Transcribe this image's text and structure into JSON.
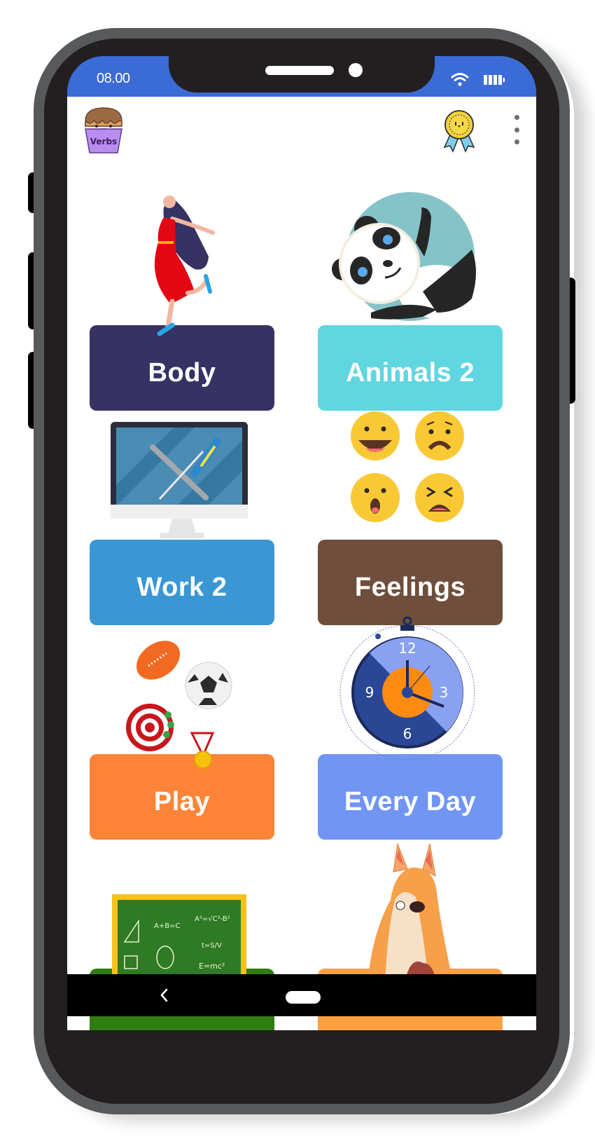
{
  "status_bar": {
    "time": "08.00",
    "icons": [
      "wifi-icon",
      "battery-icon"
    ]
  },
  "app_bar": {
    "logo_text": "Verbs",
    "logo_icon": "cupcake-icon",
    "award_icon": "award-medal-icon",
    "menu_icon": "more-vertical-icon"
  },
  "categories": [
    {
      "label": "Body",
      "color": "#363264",
      "icon": "dancing-woman-icon"
    },
    {
      "label": "Animals 2",
      "color": "#5fd6e0",
      "icon": "panda-icon"
    },
    {
      "label": "Work 2",
      "color": "#3a97d4",
      "icon": "computer-tools-icon"
    },
    {
      "label": "Feelings",
      "color": "#6f4f3b",
      "icon": "emoji-faces-icon"
    },
    {
      "label": "Play",
      "color": "#fd8337",
      "icon": "sports-balls-icon"
    },
    {
      "label": "Every Day",
      "color": "#7095f3",
      "icon": "clock-icon"
    },
    {
      "label": "",
      "color": "#2f7e11",
      "icon": "chalkboard-icon"
    },
    {
      "label": "",
      "color": "#fda042",
      "icon": "dog-icon"
    }
  ],
  "nav_bar": {
    "back_icon": "back-chevron-icon",
    "home_icon": "home-pill-icon"
  }
}
